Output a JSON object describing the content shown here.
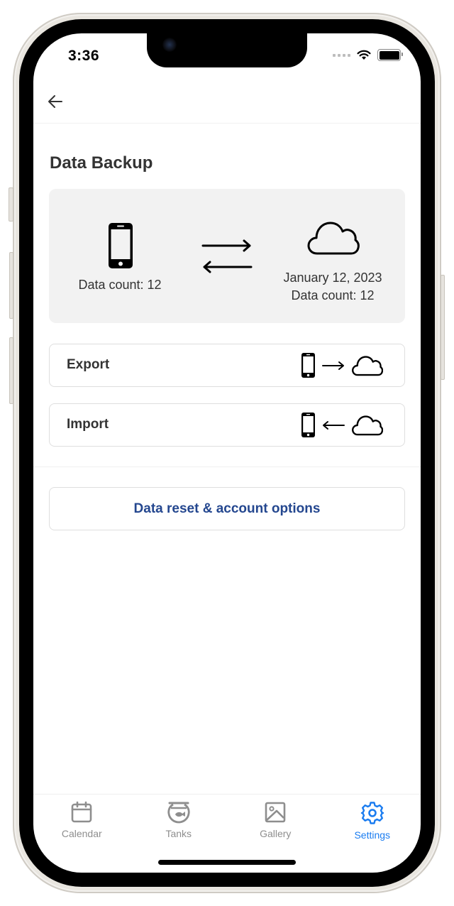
{
  "status_bar": {
    "time": "3:36"
  },
  "header": {
    "back_icon": "arrow-left-icon"
  },
  "page": {
    "title": "Data Backup"
  },
  "backup_card": {
    "local": {
      "icon": "smartphone-icon",
      "data_count_label": "Data count: 12"
    },
    "sync_icon": "sync-arrows-icon",
    "cloud": {
      "icon": "cloud-icon",
      "last_backup_date": "January 12, 2023",
      "data_count_label": "Data count: 12"
    }
  },
  "actions": [
    {
      "label": "Export",
      "direction": "phone-to-cloud"
    },
    {
      "label": "Import",
      "direction": "cloud-to-phone"
    }
  ],
  "reset_button": {
    "label": "Data reset & account options",
    "color": "#24478f"
  },
  "tab_bar": {
    "active_color": "#1a7cf0",
    "inactive_color": "#8e8e8e",
    "tabs": [
      {
        "label": "Calendar",
        "icon": "calendar-icon",
        "active": false
      },
      {
        "label": "Tanks",
        "icon": "fishbowl-icon",
        "active": false
      },
      {
        "label": "Gallery",
        "icon": "image-icon",
        "active": false
      },
      {
        "label": "Settings",
        "icon": "gear-icon",
        "active": true
      }
    ]
  }
}
